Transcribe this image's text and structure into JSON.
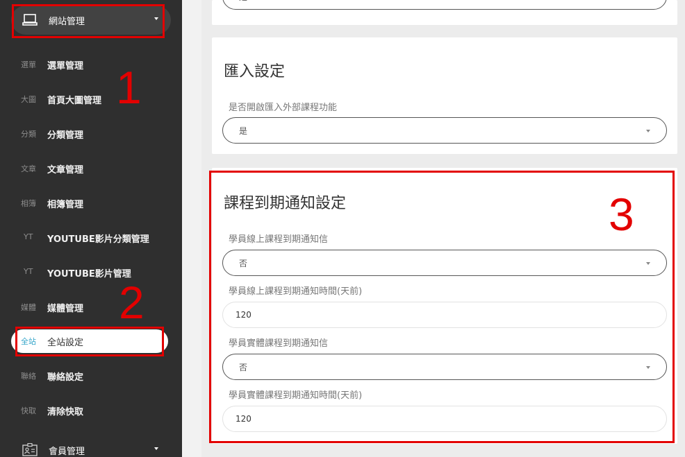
{
  "sidebar": {
    "website_section": {
      "label": "網站管理",
      "icon": "monitor-icon"
    },
    "items": [
      {
        "abbr": "選單",
        "label": "選單管理"
      },
      {
        "abbr": "大圖",
        "label": "首頁大圖管理"
      },
      {
        "abbr": "分類",
        "label": "分類管理"
      },
      {
        "abbr": "文章",
        "label": "文章管理"
      },
      {
        "abbr": "相簿",
        "label": "相簿管理"
      },
      {
        "abbr": "YT",
        "label": "YOUTUBE影片分類管理"
      },
      {
        "abbr": "YT",
        "label": "YOUTUBE影片管理"
      },
      {
        "abbr": "媒體",
        "label": "媒體管理"
      },
      {
        "abbr": "全站",
        "label": "全站設定"
      },
      {
        "abbr": "聯絡",
        "label": "聯絡設定"
      },
      {
        "abbr": "快取",
        "label": "清除快取"
      }
    ],
    "member_section": {
      "label": "會員管理",
      "icon": "id-card-icon"
    }
  },
  "top_card": {
    "select_value": "是"
  },
  "import_card": {
    "title": "匯入設定",
    "field_label": "是否開啟匯入外部課程功能",
    "field_value": "是"
  },
  "expiry_card": {
    "title": "課程到期通知設定",
    "fields": [
      {
        "label": "學員線上課程到期通知信",
        "value": "否"
      },
      {
        "label": "學員線上課程到期通知時間(天前)",
        "value": "120"
      },
      {
        "label": "學員實體課程到期通知信",
        "value": "否"
      },
      {
        "label": "學員實體課程到期通知時間(天前)",
        "value": "120"
      }
    ]
  },
  "annotations": {
    "n1": "1",
    "n2": "2",
    "n3": "3",
    "color": "#e30000"
  }
}
